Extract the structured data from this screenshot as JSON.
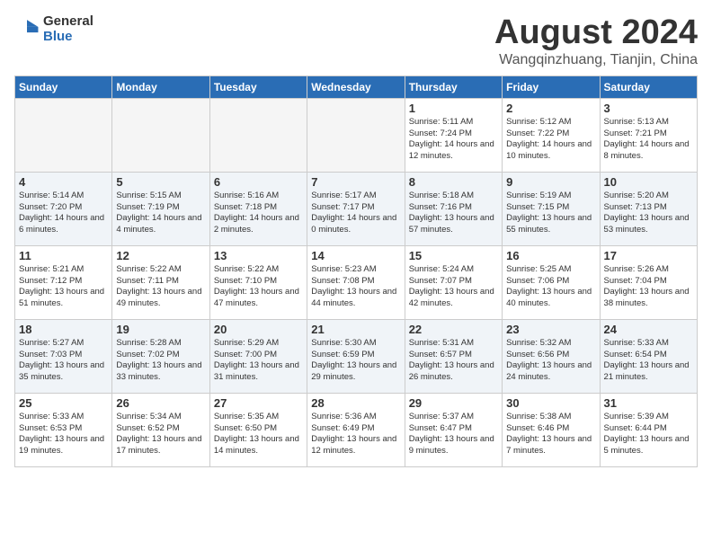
{
  "logo": {
    "general": "General",
    "blue": "Blue"
  },
  "title": "August 2024",
  "location": "Wangqinzhuang, Tianjin, China",
  "days_of_week": [
    "Sunday",
    "Monday",
    "Tuesday",
    "Wednesday",
    "Thursday",
    "Friday",
    "Saturday"
  ],
  "weeks": [
    [
      {
        "day": "",
        "empty": true
      },
      {
        "day": "",
        "empty": true
      },
      {
        "day": "",
        "empty": true
      },
      {
        "day": "",
        "empty": true
      },
      {
        "day": "1",
        "sunrise": "5:11 AM",
        "sunset": "7:24 PM",
        "daylight": "14 hours and 12 minutes."
      },
      {
        "day": "2",
        "sunrise": "5:12 AM",
        "sunset": "7:22 PM",
        "daylight": "14 hours and 10 minutes."
      },
      {
        "day": "3",
        "sunrise": "5:13 AM",
        "sunset": "7:21 PM",
        "daylight": "14 hours and 8 minutes."
      }
    ],
    [
      {
        "day": "4",
        "sunrise": "5:14 AM",
        "sunset": "7:20 PM",
        "daylight": "14 hours and 6 minutes."
      },
      {
        "day": "5",
        "sunrise": "5:15 AM",
        "sunset": "7:19 PM",
        "daylight": "14 hours and 4 minutes."
      },
      {
        "day": "6",
        "sunrise": "5:16 AM",
        "sunset": "7:18 PM",
        "daylight": "14 hours and 2 minutes."
      },
      {
        "day": "7",
        "sunrise": "5:17 AM",
        "sunset": "7:17 PM",
        "daylight": "14 hours and 0 minutes."
      },
      {
        "day": "8",
        "sunrise": "5:18 AM",
        "sunset": "7:16 PM",
        "daylight": "13 hours and 57 minutes."
      },
      {
        "day": "9",
        "sunrise": "5:19 AM",
        "sunset": "7:15 PM",
        "daylight": "13 hours and 55 minutes."
      },
      {
        "day": "10",
        "sunrise": "5:20 AM",
        "sunset": "7:13 PM",
        "daylight": "13 hours and 53 minutes."
      }
    ],
    [
      {
        "day": "11",
        "sunrise": "5:21 AM",
        "sunset": "7:12 PM",
        "daylight": "13 hours and 51 minutes."
      },
      {
        "day": "12",
        "sunrise": "5:22 AM",
        "sunset": "7:11 PM",
        "daylight": "13 hours and 49 minutes."
      },
      {
        "day": "13",
        "sunrise": "5:22 AM",
        "sunset": "7:10 PM",
        "daylight": "13 hours and 47 minutes."
      },
      {
        "day": "14",
        "sunrise": "5:23 AM",
        "sunset": "7:08 PM",
        "daylight": "13 hours and 44 minutes."
      },
      {
        "day": "15",
        "sunrise": "5:24 AM",
        "sunset": "7:07 PM",
        "daylight": "13 hours and 42 minutes."
      },
      {
        "day": "16",
        "sunrise": "5:25 AM",
        "sunset": "7:06 PM",
        "daylight": "13 hours and 40 minutes."
      },
      {
        "day": "17",
        "sunrise": "5:26 AM",
        "sunset": "7:04 PM",
        "daylight": "13 hours and 38 minutes."
      }
    ],
    [
      {
        "day": "18",
        "sunrise": "5:27 AM",
        "sunset": "7:03 PM",
        "daylight": "13 hours and 35 minutes."
      },
      {
        "day": "19",
        "sunrise": "5:28 AM",
        "sunset": "7:02 PM",
        "daylight": "13 hours and 33 minutes."
      },
      {
        "day": "20",
        "sunrise": "5:29 AM",
        "sunset": "7:00 PM",
        "daylight": "13 hours and 31 minutes."
      },
      {
        "day": "21",
        "sunrise": "5:30 AM",
        "sunset": "6:59 PM",
        "daylight": "13 hours and 29 minutes."
      },
      {
        "day": "22",
        "sunrise": "5:31 AM",
        "sunset": "6:57 PM",
        "daylight": "13 hours and 26 minutes."
      },
      {
        "day": "23",
        "sunrise": "5:32 AM",
        "sunset": "6:56 PM",
        "daylight": "13 hours and 24 minutes."
      },
      {
        "day": "24",
        "sunrise": "5:33 AM",
        "sunset": "6:54 PM",
        "daylight": "13 hours and 21 minutes."
      }
    ],
    [
      {
        "day": "25",
        "sunrise": "5:33 AM",
        "sunset": "6:53 PM",
        "daylight": "13 hours and 19 minutes."
      },
      {
        "day": "26",
        "sunrise": "5:34 AM",
        "sunset": "6:52 PM",
        "daylight": "13 hours and 17 minutes."
      },
      {
        "day": "27",
        "sunrise": "5:35 AM",
        "sunset": "6:50 PM",
        "daylight": "13 hours and 14 minutes."
      },
      {
        "day": "28",
        "sunrise": "5:36 AM",
        "sunset": "6:49 PM",
        "daylight": "13 hours and 12 minutes."
      },
      {
        "day": "29",
        "sunrise": "5:37 AM",
        "sunset": "6:47 PM",
        "daylight": "13 hours and 9 minutes."
      },
      {
        "day": "30",
        "sunrise": "5:38 AM",
        "sunset": "6:46 PM",
        "daylight": "13 hours and 7 minutes."
      },
      {
        "day": "31",
        "sunrise": "5:39 AM",
        "sunset": "6:44 PM",
        "daylight": "13 hours and 5 minutes."
      }
    ]
  ]
}
